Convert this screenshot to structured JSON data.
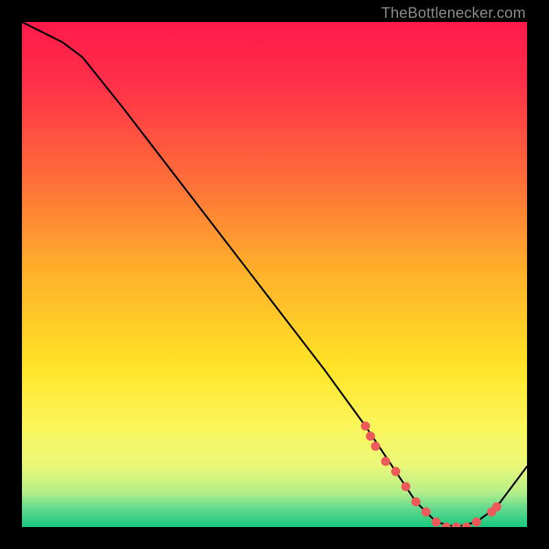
{
  "watermark": "TheBottlenecker.com",
  "chart_data": {
    "type": "line",
    "title": "",
    "xlabel": "",
    "ylabel": "",
    "xlim": [
      0,
      100
    ],
    "ylim": [
      0,
      100
    ],
    "series": [
      {
        "name": "curve",
        "x": [
          0,
          8,
          12,
          20,
          30,
          40,
          50,
          60,
          68,
          74,
          78,
          82,
          86,
          90,
          94,
          100
        ],
        "y": [
          100,
          96,
          93,
          83,
          70,
          57,
          44,
          31,
          20,
          11,
          5,
          1,
          0,
          1,
          4,
          12
        ]
      }
    ],
    "markers": {
      "name": "highlight-points",
      "color": "#ec5a5a",
      "x": [
        68,
        69,
        70,
        72,
        74,
        76,
        78,
        80,
        82,
        84,
        86,
        88,
        90,
        93,
        94
      ],
      "y": [
        20,
        18,
        16,
        13,
        11,
        8,
        5,
        3,
        1,
        0,
        0,
        0,
        1,
        3,
        4
      ]
    },
    "background_gradient": {
      "stops": [
        {
          "pos": 0.0,
          "color": "#ff1a4b"
        },
        {
          "pos": 0.12,
          "color": "#ff2f4a"
        },
        {
          "pos": 0.3,
          "color": "#ff6a3a"
        },
        {
          "pos": 0.5,
          "color": "#ffb22a"
        },
        {
          "pos": 0.68,
          "color": "#ffe326"
        },
        {
          "pos": 0.8,
          "color": "#fbf65a"
        },
        {
          "pos": 0.88,
          "color": "#e8f77a"
        },
        {
          "pos": 0.93,
          "color": "#b6ef88"
        },
        {
          "pos": 0.965,
          "color": "#5fd98f"
        },
        {
          "pos": 1.0,
          "color": "#17c87c"
        }
      ]
    }
  }
}
